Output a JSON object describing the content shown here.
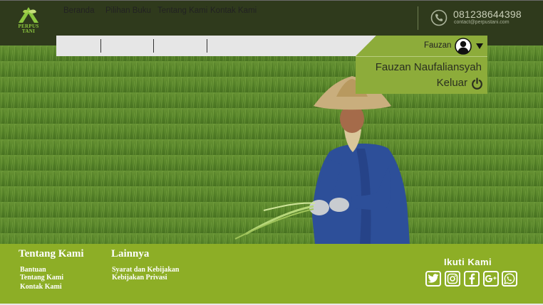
{
  "logo": {
    "line1": "PERPUS",
    "line2": "TANI"
  },
  "contact": {
    "phone": "081238644398",
    "email": "contact@perpustani.com"
  },
  "nav": {
    "items": [
      {
        "label": "Beranda"
      },
      {
        "label": "Pilihan Buku"
      },
      {
        "label": "Tentang Kami"
      },
      {
        "label": "Kontak Kami"
      }
    ]
  },
  "user": {
    "short_name": "Fauzan",
    "full_name": "Fauzan Naufaliansyah",
    "logout_label": "Keluar"
  },
  "footer": {
    "about": {
      "title": "Tentang Kami",
      "links": [
        "Bantuan",
        "Tentang Kami",
        "Kontak Kami"
      ]
    },
    "others": {
      "title": "Lainnya",
      "links": [
        "Syarat dan Kebijakan",
        "Kebijakan Privasi"
      ]
    },
    "follow_title": "Ikuti Kami",
    "socials": [
      "twitter-icon",
      "instagram-icon",
      "facebook-icon",
      "google-plus-icon",
      "whatsapp-icon"
    ]
  },
  "colors": {
    "header_bg": "#2f3a1c",
    "accent_green": "#8dac3a",
    "footer_green": "#8dae26",
    "nav_bg": "#e6e6e6"
  }
}
